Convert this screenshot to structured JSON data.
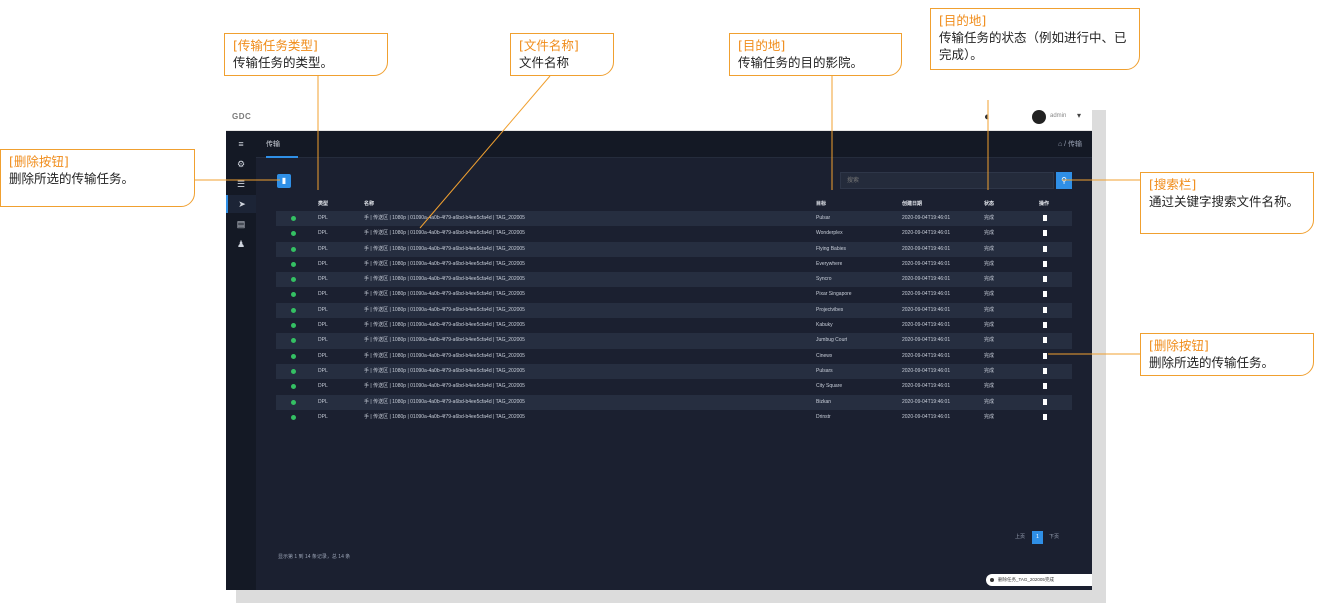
{
  "annotations": {
    "transfer_type": {
      "title": "[传输任务类型]",
      "desc": "传输任务的类型。"
    },
    "file_name": {
      "title": "[文件名称]",
      "desc": "文件名称"
    },
    "destination": {
      "title": "[目的地]",
      "desc": "传输任务的目的影院。"
    },
    "status": {
      "title": "[目的地]",
      "desc": "传输任务的状态（例如进行中、已完成）。"
    },
    "delete_top": {
      "title": "[删除按钮]",
      "desc": "删除所选的传输任务。"
    },
    "search": {
      "title": "[搜索栏]",
      "desc": "通过关键字搜索文件名称。"
    },
    "delete_row": {
      "title": "[删除按钮]",
      "desc": "删除所选的传输任务。"
    }
  },
  "app": {
    "logo": "GDC",
    "bell_icon": "bell-icon",
    "user_name": "admin",
    "user_caret": "▾"
  },
  "sidebar_icons": [
    "menu-icon",
    "gear-icon",
    "list-icon",
    "send-icon",
    "folder-icon",
    "user-icon"
  ],
  "tab": {
    "label": "传输"
  },
  "breadcrumb": "⌂ / 传输",
  "search": {
    "placeholder": "搜索"
  },
  "table": {
    "headers": {
      "type": "类型",
      "name": "名称",
      "dest": "目标",
      "date": "创建日期",
      "status": "状态",
      "action": "操作"
    },
    "rows": [
      {
        "type": "DPL",
        "name": "手 | 传送区 | 1080p | 01090a-4a0b-4f79-a6bd-b4ee5cfa4d | TAG_202005",
        "dest": "Pulsar",
        "date": "2020-09-04T19:46:01",
        "status": "完成"
      },
      {
        "type": "DPL",
        "name": "手 | 传送区 | 1080p | 01090a-4a0b-4f79-a6bd-b4ee5cfa4d | TAG_202005",
        "dest": "Wonderplex",
        "date": "2020-09-04T19:46:01",
        "status": "完成"
      },
      {
        "type": "DPL",
        "name": "手 | 传送区 | 1080p | 01090a-4a0b-4f79-a6bd-b4ee5cfa4d | TAG_202005",
        "dest": "Flying Babies",
        "date": "2020-09-04T19:46:01",
        "status": "完成"
      },
      {
        "type": "DPL",
        "name": "手 | 传送区 | 1080p | 01090a-4a0b-4f79-a6bd-b4ee5cfa4d | TAG_202005",
        "dest": "Everywhere",
        "date": "2020-09-04T19:46:01",
        "status": "完成"
      },
      {
        "type": "DPL",
        "name": "手 | 传送区 | 1080p | 01090a-4a0b-4f79-a6bd-b4ee5cfa4d | TAG_202005",
        "dest": "Syncro",
        "date": "2020-09-04T19:46:01",
        "status": "完成"
      },
      {
        "type": "DPL",
        "name": "手 | 传送区 | 1080p | 01090a-4a0b-4f79-a6bd-b4ee5cfa4d | TAG_202005",
        "dest": "Pixar Singapore",
        "date": "2020-09-04T19:46:01",
        "status": "完成"
      },
      {
        "type": "DPL",
        "name": "手 | 传送区 | 1080p | 01090a-4a0b-4f79-a6bd-b4ee5cfa4d | TAG_202005",
        "dest": "Projectvibes",
        "date": "2020-09-04T19:46:01",
        "status": "完成"
      },
      {
        "type": "DPL",
        "name": "手 | 传送区 | 1080p | 01090a-4a0b-4f79-a6bd-b4ee5cfa4d | TAG_202005",
        "dest": "Kabuky",
        "date": "2020-09-04T19:46:01",
        "status": "完成"
      },
      {
        "type": "DPL",
        "name": "手 | 传送区 | 1080p | 01090a-4a0b-4f79-a6bd-b4ee5cfa4d | TAG_202005",
        "dest": "Jumbug Court",
        "date": "2020-09-04T19:46:01",
        "status": "完成"
      },
      {
        "type": "DPL",
        "name": "手 | 传送区 | 1080p | 01090a-4a0b-4f79-a6bd-b4ee5cfa4d | TAG_202005",
        "dest": "Cinewx",
        "date": "2020-09-04T19:46:01",
        "status": "完成"
      },
      {
        "type": "DPL",
        "name": "手 | 传送区 | 1080p | 01090a-4a0b-4f79-a6bd-b4ee5cfa4d | TAG_202005",
        "dest": "Pulsars",
        "date": "2020-09-04T19:46:01",
        "status": "完成"
      },
      {
        "type": "DPL",
        "name": "手 | 传送区 | 1080p | 01090a-4a0b-4f79-a6bd-b4ee5cfa4d | TAG_202005",
        "dest": "City Square",
        "date": "2020-09-04T19:46:01",
        "status": "完成"
      },
      {
        "type": "DPL",
        "name": "手 | 传送区 | 1080p | 01090a-4a0b-4f79-a6bd-b4ee5cfa4d | TAG_202005",
        "dest": "Bizkan",
        "date": "2020-09-04T19:46:01",
        "status": "完成"
      },
      {
        "type": "DPL",
        "name": "手 | 传送区 | 1080p | 01090a-4a0b-4f79-a6bd-b4ee5cfa4d | TAG_202005",
        "dest": "Drinstr",
        "date": "2020-09-04T19:46:01",
        "status": "完成"
      }
    ]
  },
  "footer": {
    "summary": "显示第 1 到 14 条记录，总 14 条"
  },
  "pagination": {
    "prev": "上页",
    "current": "1",
    "next": "下页"
  },
  "toast": "删除任务_TAG_202005完成"
}
